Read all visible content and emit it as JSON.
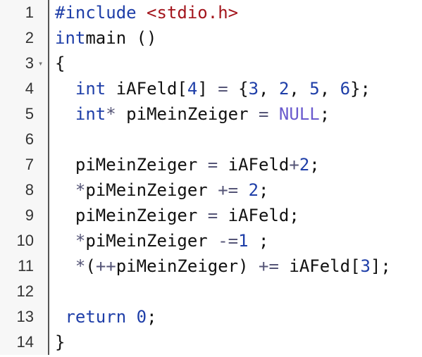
{
  "lines": [
    {
      "no": "1",
      "tokens": [
        [
          "inc",
          "#include "
        ],
        [
          "hdr",
          "<stdio.h>"
        ]
      ]
    },
    {
      "no": "2",
      "tokens": [
        [
          "kw",
          "int"
        ],
        [
          "",
          "main ()"
        ]
      ]
    },
    {
      "no": "3",
      "tokens": [
        [
          "",
          "{"
        ]
      ],
      "fold": true
    },
    {
      "no": "4",
      "tokens": [
        [
          "",
          "  "
        ],
        [
          "kw",
          "int"
        ],
        [
          "",
          " iAFeld["
        ],
        [
          "num",
          "4"
        ],
        [
          "",
          "] "
        ],
        [
          "op",
          "="
        ],
        [
          "",
          " {"
        ],
        [
          "num",
          "3"
        ],
        [
          "",
          ", "
        ],
        [
          "num",
          "2"
        ],
        [
          "",
          ", "
        ],
        [
          "num",
          "5"
        ],
        [
          "",
          ", "
        ],
        [
          "num",
          "6"
        ],
        [
          "",
          "};"
        ]
      ]
    },
    {
      "no": "5",
      "tokens": [
        [
          "",
          "  "
        ],
        [
          "kw",
          "int"
        ],
        [
          "op",
          "*"
        ],
        [
          "",
          " piMeinZeiger "
        ],
        [
          "op",
          "="
        ],
        [
          "",
          " "
        ],
        [
          "null",
          "NULL"
        ],
        [
          "",
          ";"
        ]
      ]
    },
    {
      "no": "6",
      "tokens": []
    },
    {
      "no": "7",
      "tokens": [
        [
          "",
          "  piMeinZeiger "
        ],
        [
          "op",
          "="
        ],
        [
          "",
          " iAFeld"
        ],
        [
          "op",
          "+"
        ],
        [
          "num",
          "2"
        ],
        [
          "",
          ";"
        ]
      ]
    },
    {
      "no": "8",
      "tokens": [
        [
          "",
          "  "
        ],
        [
          "op",
          "*"
        ],
        [
          "",
          "piMeinZeiger "
        ],
        [
          "op",
          "+="
        ],
        [
          "",
          " "
        ],
        [
          "num",
          "2"
        ],
        [
          "",
          ";"
        ]
      ]
    },
    {
      "no": "9",
      "tokens": [
        [
          "",
          "  piMeinZeiger "
        ],
        [
          "op",
          "="
        ],
        [
          "",
          " iAFeld;"
        ]
      ]
    },
    {
      "no": "10",
      "tokens": [
        [
          "",
          "  "
        ],
        [
          "op",
          "*"
        ],
        [
          "",
          "piMeinZeiger "
        ],
        [
          "op",
          "-="
        ],
        [
          "num",
          "1"
        ],
        [
          "",
          " ;"
        ]
      ]
    },
    {
      "no": "11",
      "tokens": [
        [
          "",
          "  "
        ],
        [
          "op",
          "*"
        ],
        [
          "",
          "("
        ],
        [
          "op",
          "++"
        ],
        [
          "",
          "piMeinZeiger) "
        ],
        [
          "op",
          "+="
        ],
        [
          "",
          " iAFeld["
        ],
        [
          "num",
          "3"
        ],
        [
          "",
          "];"
        ]
      ]
    },
    {
      "no": "12",
      "tokens": []
    },
    {
      "no": "13",
      "tokens": [
        [
          "",
          ""
        ],
        [
          "kw",
          " return"
        ],
        [
          "",
          " "
        ],
        [
          "num",
          "0"
        ],
        [
          "",
          ";"
        ]
      ]
    },
    {
      "no": "14",
      "tokens": [
        [
          "",
          "}"
        ]
      ]
    }
  ],
  "fold_glyph": "▾",
  "colors": {
    "keyword": "#1e3ea8",
    "header": "#a3151c",
    "gutter_bg": "#f7f7f7"
  }
}
